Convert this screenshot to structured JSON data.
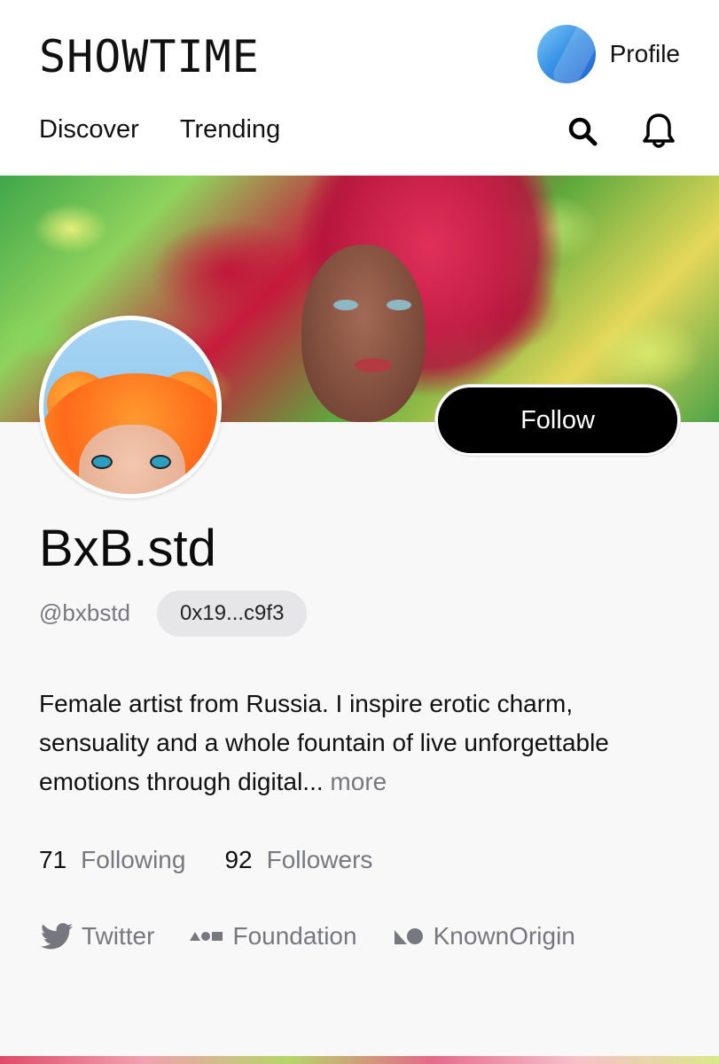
{
  "app": {
    "logo_text": "SHOWTIME",
    "profile_label": "Profile"
  },
  "nav": {
    "items": [
      "Discover",
      "Trending"
    ]
  },
  "header_icons": [
    "search-icon",
    "bell-icon"
  ],
  "profile": {
    "display_name": "BxB.std",
    "handle": "@bxbstd",
    "address": "0x19...c9f3",
    "follow_label": "Follow",
    "bio": "Female artist from Russia. I inspire erotic charm, sensuality and a whole fountain of live unforgettable emotions through digital...",
    "bio_more": "more"
  },
  "stats": {
    "following_count": "71",
    "following_label": "Following",
    "followers_count": "92",
    "followers_label": "Followers"
  },
  "links": [
    {
      "label": "Twitter",
      "icon": "twitter-icon"
    },
    {
      "label": "Foundation",
      "icon": "foundation-icon"
    },
    {
      "label": "KnownOrigin",
      "icon": "knownorigin-icon"
    }
  ],
  "colors": {
    "text_primary": "#111111",
    "text_muted": "#77777f",
    "button_bg": "#000000",
    "chip_bg": "#e6e6e9",
    "content_bg": "#f8f8f9"
  }
}
